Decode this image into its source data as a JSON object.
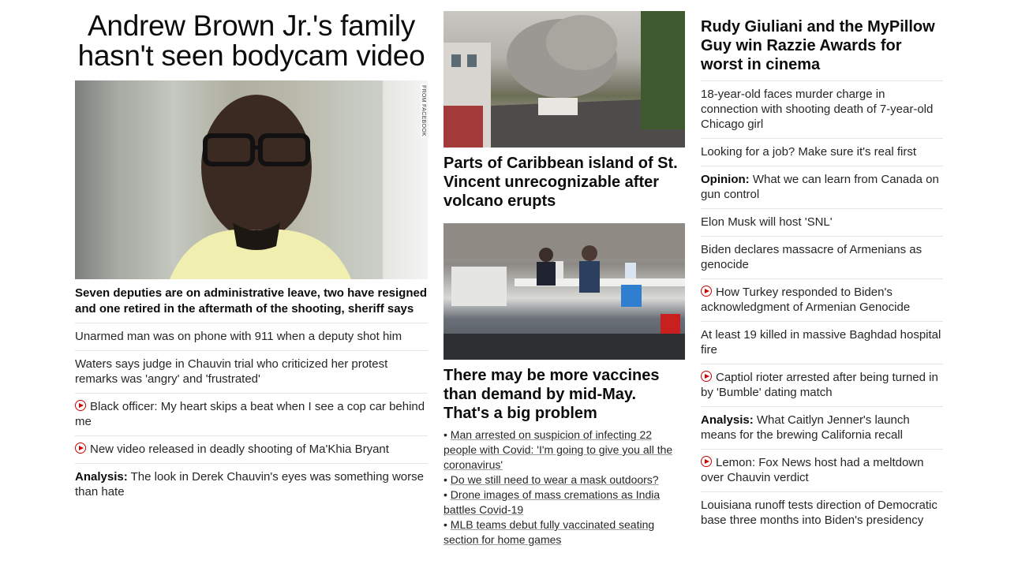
{
  "col1": {
    "main_headline": "Andrew Brown Jr.'s family hasn't seen bodycam video",
    "image_credit": "FROM FACEBOOK",
    "image_subject": "portrait-of-man-with-glasses-in-car",
    "sub_headline": "Seven deputies are on administrative leave, two have resigned and one retired in the aftermath of the shooting, sheriff says",
    "items": [
      {
        "prefix": "",
        "video": false,
        "text": "Unarmed man was on phone with 911 when a deputy shot him"
      },
      {
        "prefix": "",
        "video": false,
        "text": "Waters says judge in Chauvin trial who criticized her protest remarks was 'angry' and 'frustrated'"
      },
      {
        "prefix": "",
        "video": true,
        "text": "Black officer: My heart skips a beat when I see a cop car behind me"
      },
      {
        "prefix": "",
        "video": true,
        "text": "New video released in deadly shooting of Ma'Khia Bryant"
      },
      {
        "prefix": "Analysis:",
        "video": false,
        "text": "The look in Derek Chauvin's eyes was something worse than hate"
      }
    ]
  },
  "col2": {
    "story1": {
      "image_subject": "volcano-ash-plume-over-town",
      "headline": "Parts of Caribbean island of St. Vincent unrecognizable after volcano erupts"
    },
    "story2": {
      "image_subject": "vaccination-site-workers-at-table",
      "headline": "There may be more vaccines than demand by mid-May. That's a big problem",
      "bullets": [
        "Man arrested on suspicion of infecting 22 people with Covid: 'I'm going to give you all the coronavirus'",
        "Do we still need to wear a mask outdoors?",
        "Drone images of mass cremations as India battles Covid-19",
        "MLB teams debut fully vaccinated seating section for home games"
      ]
    }
  },
  "col3": {
    "top_headline": "Rudy Giuliani and the MyPillow Guy win Razzie Awards for worst in cinema",
    "items": [
      {
        "prefix": "",
        "video": false,
        "text": "18-year-old faces murder charge in connection with shooting death of 7-year-old Chicago girl"
      },
      {
        "prefix": "",
        "video": false,
        "text": "Looking for a job? Make sure it's real first"
      },
      {
        "prefix": "Opinion:",
        "video": false,
        "text": "What we can learn from Canada on gun control"
      },
      {
        "prefix": "",
        "video": false,
        "text": "Elon Musk will host 'SNL'"
      },
      {
        "prefix": "",
        "video": false,
        "text": "Biden declares massacre of Armenians as genocide"
      },
      {
        "prefix": "",
        "video": true,
        "text": "How Turkey responded to Biden's acknowledgment of Armenian Genocide"
      },
      {
        "prefix": "",
        "video": false,
        "text": "At least 19 killed in massive Baghdad hospital fire"
      },
      {
        "prefix": "",
        "video": true,
        "text": "Captiol rioter arrested after being turned in by 'Bumble' dating match"
      },
      {
        "prefix": "Analysis:",
        "video": false,
        "text": "What Caitlyn Jenner's launch means for the brewing California recall"
      },
      {
        "prefix": "",
        "video": true,
        "text": "Lemon: Fox News host had a meltdown over Chauvin verdict"
      },
      {
        "prefix": "",
        "video": false,
        "text": "Louisiana runoff tests direction of Democratic base three months into Biden's presidency"
      }
    ]
  },
  "colors": {
    "video_icon": "#cc0000",
    "divider": "#e5e5e5",
    "text": "#262626"
  }
}
